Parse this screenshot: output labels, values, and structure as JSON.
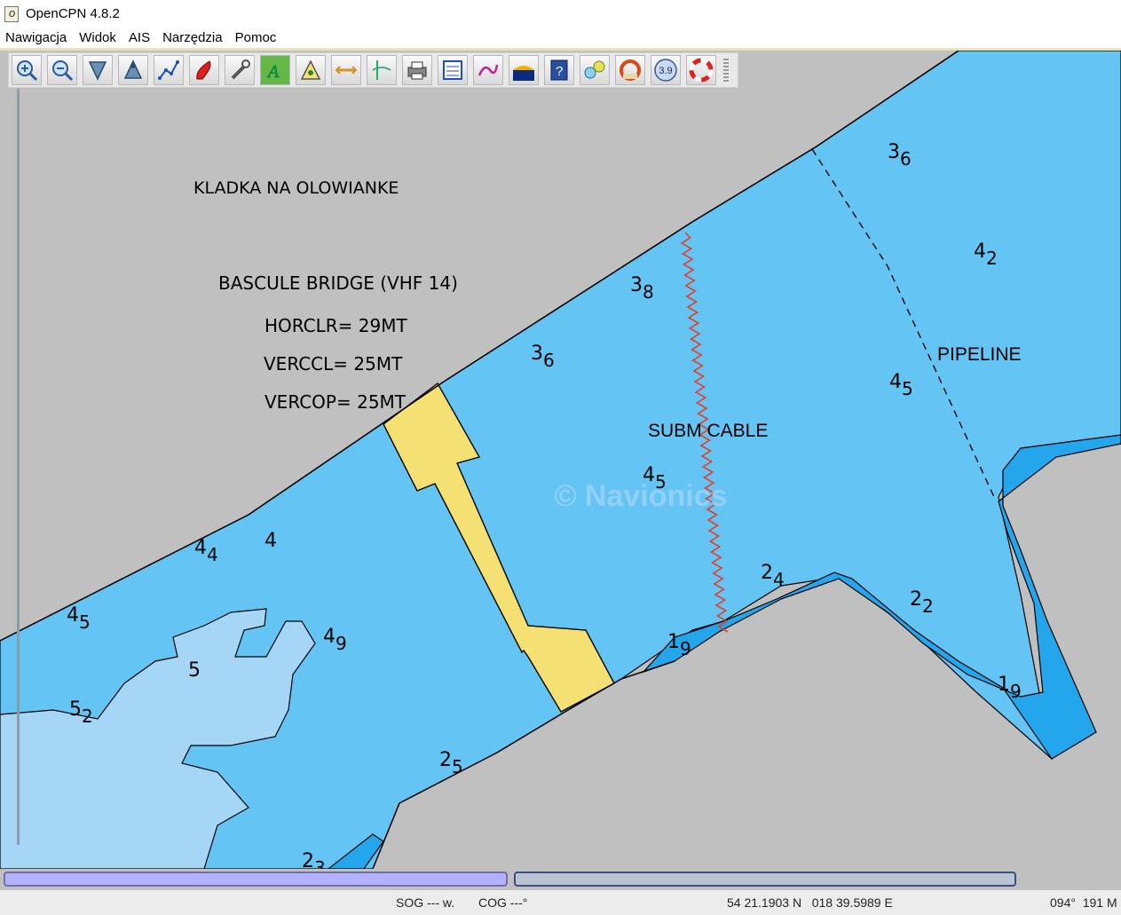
{
  "window": {
    "title": "OpenCPN 4.8.2"
  },
  "menu": [
    "Nawigacja",
    "Widok",
    "AIS",
    "Narzędzia",
    "Pomoc"
  ],
  "toolbar": {
    "buttons": [
      "zoom-in-icon",
      "zoom-out-icon",
      "scale-down-icon",
      "scale-up-icon",
      "route-icon",
      "boat-icon",
      "settings-icon",
      "text-icon",
      "tides-icon",
      "dashboard-icon",
      "measure-icon",
      "print-icon",
      "route-manager-icon",
      "track-icon",
      "ais-icon",
      "help-icon",
      "chart-info-icon",
      "mob-icon",
      "zoom-level-icon",
      "lifebuoy-icon"
    ],
    "zoom_level": "3.9"
  },
  "colors": {
    "land": "#c0c0c0",
    "shallow": "#23a6eb",
    "medium": "#64c4f4",
    "deep": "#a6d6f5",
    "bridge": "#f5e074",
    "cable": "#e0402a"
  },
  "chart": {
    "labels": {
      "kladka": "KLADKA NA OLOWIANKE",
      "bascule": "BASCULE BRIDGE (VHF 14)",
      "horclr": "HORCLR= 29MT",
      "verccl": "VERCCL= 25MT",
      "vercop": "VERCOP= 25MT",
      "subm_cable": "SUBM CABLE",
      "pipeline": "PIPELINE",
      "watermark": "© Navionics"
    },
    "soundings": [
      {
        "v": "3",
        "s": "6"
      },
      {
        "v": "4",
        "s": "2"
      },
      {
        "v": "3",
        "s": "8"
      },
      {
        "v": "3",
        "s": "6"
      },
      {
        "v": "4",
        "s": "5"
      },
      {
        "v": "4",
        "s": "5"
      },
      {
        "v": "4",
        "s": "4"
      },
      {
        "v": "4",
        "s": ""
      },
      {
        "v": "2",
        "s": "4"
      },
      {
        "v": "2",
        "s": "2"
      },
      {
        "v": "1",
        "s": "9"
      },
      {
        "v": "1",
        "s": "9"
      },
      {
        "v": "4",
        "s": "5"
      },
      {
        "v": "4",
        "s": "9"
      },
      {
        "v": "5",
        "s": ""
      },
      {
        "v": "5",
        "s": "2"
      },
      {
        "v": "2",
        "s": "5"
      },
      {
        "v": "2",
        "s": "3"
      }
    ]
  },
  "status": {
    "sog": "SOG --- w.",
    "cog": "COG ---°",
    "position": "54 21.1903 N   018 39.5989 E",
    "bearing": "094°  191 M"
  }
}
